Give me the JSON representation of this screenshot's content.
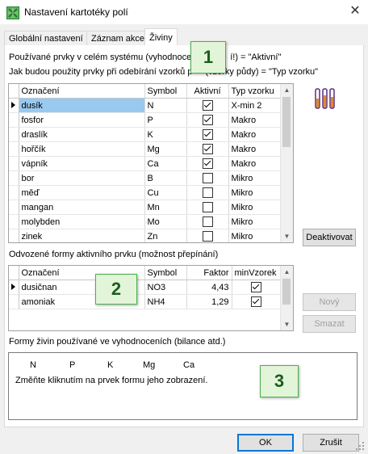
{
  "window": {
    "title": "Nastavení kartotéky polí",
    "close_glyph": "✕",
    "icon": "app-grid-icon"
  },
  "tabs": [
    {
      "label": "Globální nastavení",
      "active": false
    },
    {
      "label": "Záznam akce",
      "active": false
    },
    {
      "label": "Živiny",
      "active": true
    }
  ],
  "section1": {
    "line1": "Používané prvky v celém systému (vyhodnoce",
    "line1_end": "í!) = \"Aktivní\"",
    "line2": "Jak budou použity prvky při odebírání vzorků p",
    "line2_end": "(vzorky půdy) = \"Typ vzorku\"",
    "badge": "1",
    "columns": [
      "Označení",
      "Symbol",
      "Aktivní",
      "Typ vzorku"
    ],
    "rows": [
      {
        "name": "dusík",
        "symbol": "N",
        "active": true,
        "type": "X-min 2",
        "selected": true
      },
      {
        "name": "fosfor",
        "symbol": "P",
        "active": true,
        "type": "Makro",
        "selected": false
      },
      {
        "name": "draslík",
        "symbol": "K",
        "active": true,
        "type": "Makro",
        "selected": false
      },
      {
        "name": "hořčík",
        "symbol": "Mg",
        "active": true,
        "type": "Makro",
        "selected": false
      },
      {
        "name": "vápník",
        "symbol": "Ca",
        "active": true,
        "type": "Makro",
        "selected": false
      },
      {
        "name": "bor",
        "symbol": "B",
        "active": false,
        "type": "Mikro",
        "selected": false
      },
      {
        "name": "měď",
        "symbol": "Cu",
        "active": false,
        "type": "Mikro",
        "selected": false
      },
      {
        "name": "mangan",
        "symbol": "Mn",
        "active": false,
        "type": "Mikro",
        "selected": false
      },
      {
        "name": "molybden",
        "symbol": "Mo",
        "active": false,
        "type": "Mikro",
        "selected": false
      },
      {
        "name": "zinek",
        "symbol": "Zn",
        "active": false,
        "type": "Mikro",
        "selected": false
      }
    ],
    "deactivate_label": "Deaktivovat",
    "side_icon": "test-tubes-icon"
  },
  "section2": {
    "heading": "Odvozené formy aktivního prvku (možnost přepínání)",
    "badge": "2",
    "columns": [
      "Označení",
      "Symbol",
      "Faktor",
      "minVzorek"
    ],
    "rows": [
      {
        "name": "dusičnan",
        "symbol": "NO3",
        "factor": "4,43",
        "min": true,
        "selected": true
      },
      {
        "name": "amoniak",
        "symbol": "NH4",
        "factor": "1,29",
        "min": true,
        "selected": false
      }
    ],
    "new_label": "Nový",
    "delete_label": "Smazat"
  },
  "section3": {
    "heading": "Formy živin používané ve vyhodnoceních (bilance atd.)",
    "badge": "3",
    "elements": [
      "N",
      "P",
      "K",
      "Mg",
      "Ca"
    ],
    "hint": "Změňte kliknutím na prvek formu jeho zobrazení."
  },
  "buttons": {
    "ok": "OK",
    "cancel": "Zrušit"
  }
}
